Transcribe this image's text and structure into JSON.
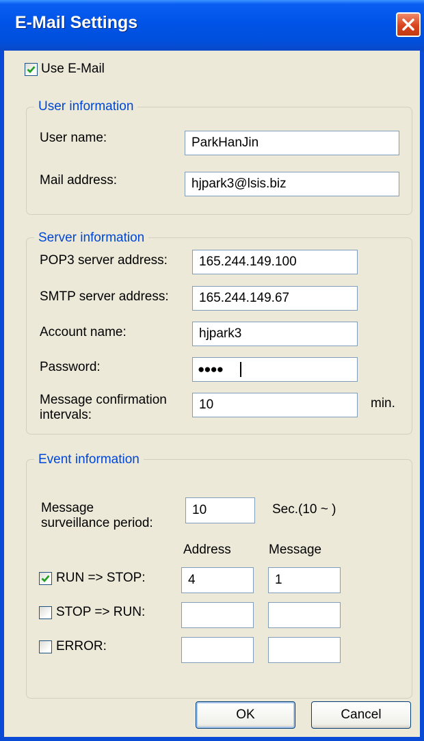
{
  "window": {
    "title": "E-Mail Settings"
  },
  "use_email": {
    "label": "Use E-Mail",
    "checked": true
  },
  "user_info": {
    "legend": "User information",
    "user_name_label": "User name:",
    "user_name_value": "ParkHanJin",
    "mail_address_label": "Mail address:",
    "mail_address_value": "hjpark3@lsis.biz"
  },
  "server_info": {
    "legend": "Server information",
    "pop3_label": "POP3 server address:",
    "pop3_value": "165.244.149.100",
    "smtp_label": "SMTP server address:",
    "smtp_value": "165.244.149.67",
    "account_label": "Account name:",
    "account_value": "hjpark3",
    "password_label": "Password:",
    "password_value": "●●●●",
    "interval_label_line1": "Message confirmation",
    "interval_label_line2": "intervals:",
    "interval_value": "10",
    "interval_unit": "min."
  },
  "event_info": {
    "legend": "Event information",
    "period_label_line1": "Message",
    "period_label_line2": "surveillance period:",
    "period_value": "10",
    "period_unit": "Sec.(10 ~ )",
    "col_address": "Address",
    "col_message": "Message",
    "rows": [
      {
        "label": "RUN => STOP:",
        "checked": true,
        "address": "4",
        "message": "1"
      },
      {
        "label": "STOP => RUN:",
        "checked": false,
        "address": "",
        "message": ""
      },
      {
        "label": "ERROR:",
        "checked": false,
        "address": "",
        "message": ""
      }
    ]
  },
  "buttons": {
    "ok": "OK",
    "cancel": "Cancel"
  }
}
